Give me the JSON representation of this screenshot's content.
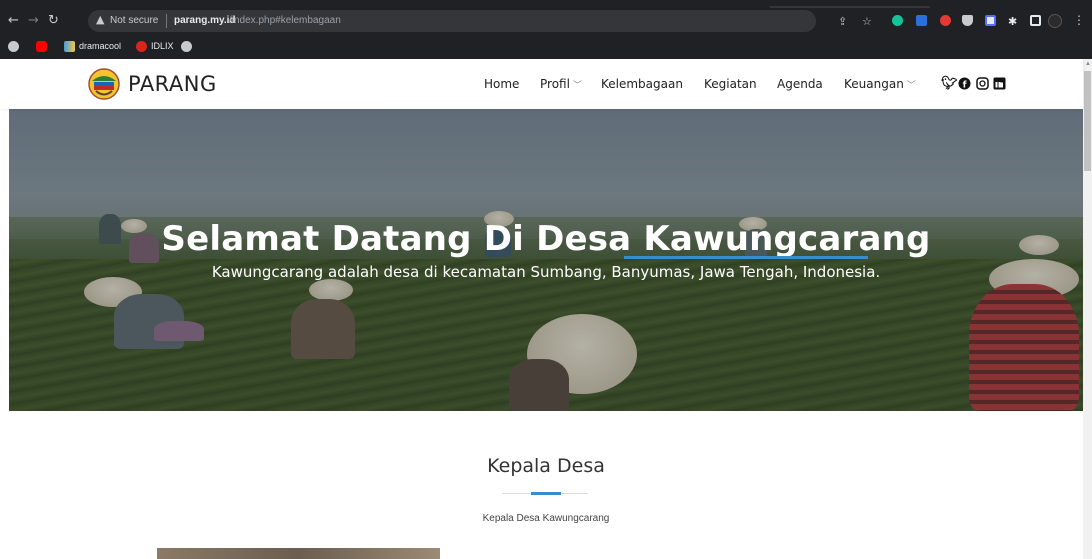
{
  "browser": {
    "omnibox": {
      "security_label": "Not secure",
      "host": "parang.my.id",
      "path": "/index.php#kelembagaan"
    },
    "nav_icons": [
      "back-icon",
      "forward-icon",
      "reload-icon"
    ],
    "toolbar_icons": [
      "share-icon",
      "star-icon",
      "grammarly-icon",
      "extension-icon",
      "extension-icon",
      "shield-icon",
      "extension-icon",
      "puzzle-icon",
      "sidebar-icon",
      "profile-avatar",
      "menu-icon"
    ],
    "bookmarks": [
      {
        "label": "",
        "icon": "globe-icon"
      },
      {
        "label": "",
        "icon": "youtube-icon",
        "color": "#ff0000"
      },
      {
        "label": "dramacool",
        "icon": "folder-icon",
        "color": "#4a9ed8"
      },
      {
        "label": "IDLIX",
        "icon": "idlix-icon",
        "color": "#d9261c"
      },
      {
        "label": "",
        "icon": "globe-icon"
      }
    ]
  },
  "site": {
    "brand": "PARANG",
    "nav": [
      {
        "label": "Home",
        "dropdown": false
      },
      {
        "label": "Profil",
        "dropdown": true
      },
      {
        "label": "Kelembagaan",
        "dropdown": false
      },
      {
        "label": "Kegiatan",
        "dropdown": false
      },
      {
        "label": "Agenda",
        "dropdown": false
      },
      {
        "label": "Keuangan",
        "dropdown": true
      }
    ],
    "social": [
      "twitter-icon",
      "facebook-icon",
      "instagram-icon",
      "linkedin-icon"
    ],
    "hero": {
      "title_prefix": "Selamat Datang Di Desa",
      "title_highlight": "Kawungcarang",
      "subtitle": "Kawungcarang adalah desa di kecamatan Sumbang, Banyumas, Jawa Tengah, Indonesia."
    },
    "section": {
      "title": "Kepala Desa",
      "subtitle": "Kepala Desa Kawungcarang"
    },
    "colors": {
      "accent": "#3a8bd0",
      "chrome_bg": "#202124",
      "omnibox_bg": "#35363a"
    }
  }
}
